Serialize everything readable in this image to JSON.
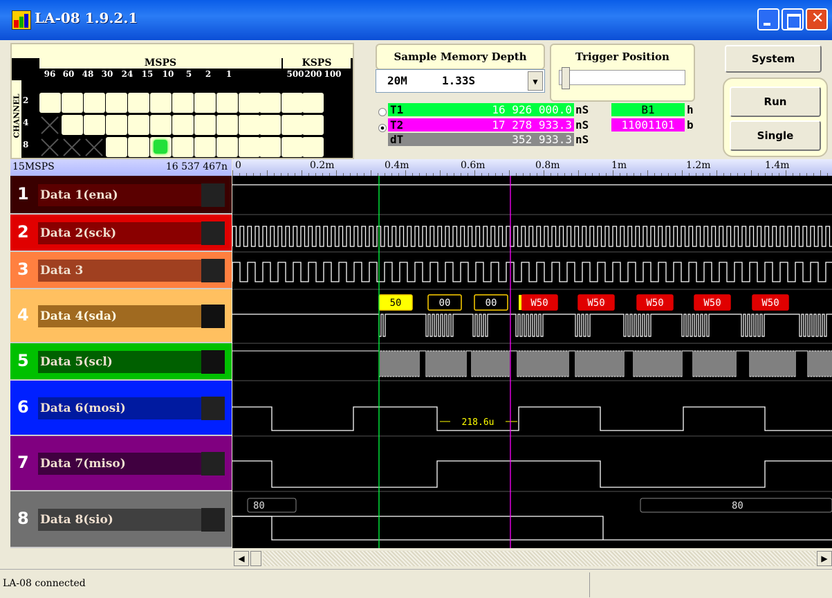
{
  "window": {
    "title": "LA-08 1.9.2.1"
  },
  "rate_grid": {
    "msps_label": "MSPS",
    "ksps_label": "KSPS",
    "channel_label": "CHANNEL",
    "rates": [
      "96",
      "60",
      "48",
      "30",
      "24",
      "15",
      "10",
      "5",
      "2",
      "1",
      "500",
      "200",
      "100"
    ],
    "channel_rows": [
      "2",
      "4",
      "8"
    ]
  },
  "memory": {
    "title": "Sample Memory Depth",
    "depth": "20M",
    "duration": "1.33S"
  },
  "trigger": {
    "title": "Trigger Position"
  },
  "buttons": {
    "system": "System",
    "run": "Run",
    "single": "Single"
  },
  "cursors": {
    "t1": {
      "label": "T1",
      "value": "16 926 000.0",
      "unit": "nS",
      "selected": false,
      "color": "#00ff40"
    },
    "t2": {
      "label": "T2",
      "value": "17 278 933.3",
      "unit": "nS",
      "selected": true,
      "color": "#ff00ff"
    },
    "dt": {
      "label": "dT",
      "value": "352 933.3",
      "unit": "nS"
    },
    "hex": {
      "value": "B1",
      "unit": "h"
    },
    "bin": {
      "value": "11001101",
      "unit": "b"
    }
  },
  "status_bar": {
    "rate": "15MSPS",
    "position": "16 537 467n"
  },
  "ruler": {
    "ticks": [
      "0",
      "0.2m",
      "0.4m",
      "0.6m",
      "0.8m",
      "1m",
      "1.2m",
      "1.4m"
    ]
  },
  "channels": [
    {
      "num": "1",
      "name": "Data 1(ena)",
      "color": "#3a0000"
    },
    {
      "num": "2",
      "name": "Data 2(sck)",
      "color": "#e00000"
    },
    {
      "num": "3",
      "name": "Data 3",
      "color": "#ff8040"
    },
    {
      "num": "4",
      "name": "Data 4(sda)",
      "color": "#ffc060"
    },
    {
      "num": "5",
      "name": "Data 5(scl)",
      "color": "#00c000"
    },
    {
      "num": "6",
      "name": "Data 6(mosi)",
      "color": "#0020ff"
    },
    {
      "num": "7",
      "name": "Data 7(miso)",
      "color": "#800080"
    },
    {
      "num": "8",
      "name": "Data 8(sio)",
      "color": "#707070"
    }
  ],
  "decode": {
    "sda_labels": [
      "50",
      "00",
      "00",
      "W50",
      "W50",
      "W50",
      "W50",
      "W50"
    ],
    "mosi_measure": "218.6u",
    "sio_labels": [
      "80",
      "80"
    ]
  },
  "statusbar": {
    "text": "LA-08 connected"
  }
}
